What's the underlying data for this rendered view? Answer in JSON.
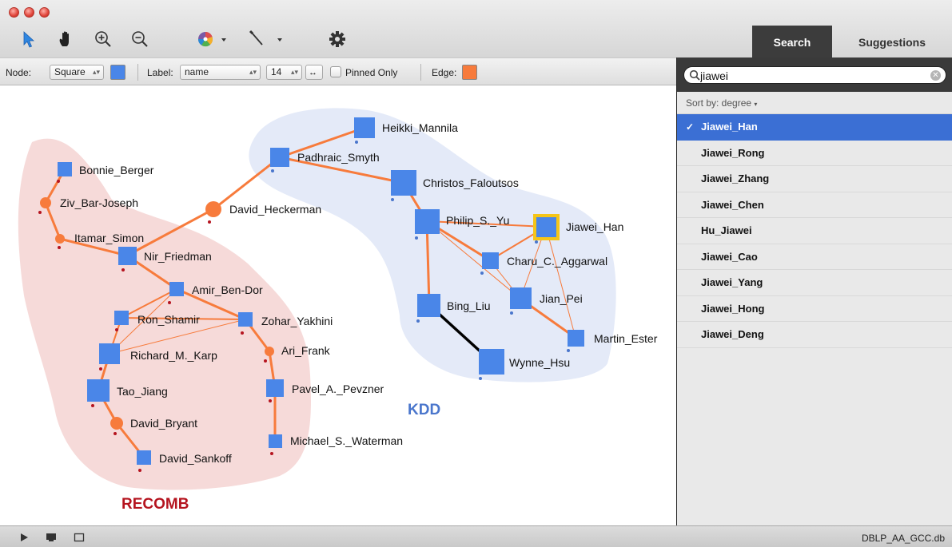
{
  "window": {
    "title_buttons": [
      "close",
      "minimize",
      "zoom"
    ]
  },
  "toolbar": {
    "tools": [
      "pointer-icon",
      "hand-icon",
      "zoom-in-icon",
      "zoom-out-icon",
      "color-wheel-icon",
      "dropdown-arrow-icon",
      "pen-icon",
      "dropdown-arrow-icon",
      "gear-icon"
    ]
  },
  "tabs": {
    "search": "Search",
    "suggestions": "Suggestions"
  },
  "options": {
    "node_label": "Node:",
    "node_shape": "Square",
    "node_color": "#4a86e8",
    "label_label": "Label:",
    "label_field": "name",
    "font_size": "14",
    "pinned_only": "Pinned Only",
    "edge_label": "Edge:",
    "edge_color": "#f77b3c"
  },
  "graph": {
    "clusters": [
      {
        "id": "recomb",
        "label": "RECOMB",
        "color": "#b5141f"
      },
      {
        "id": "kdd",
        "label": "KDD",
        "color": "#4a76cc"
      }
    ],
    "nodes": [
      {
        "id": "bonnie_berger",
        "label": "Bonnie_Berger"
      },
      {
        "id": "ziv_bar_joseph",
        "label": "Ziv_Bar-Joseph"
      },
      {
        "id": "itamar_simon",
        "label": "Itamar_Simon"
      },
      {
        "id": "nir_friedman",
        "label": "Nir_Friedman"
      },
      {
        "id": "amir_ben_dor",
        "label": "Amir_Ben-Dor"
      },
      {
        "id": "ron_shamir",
        "label": "Ron_Shamir"
      },
      {
        "id": "zohar_yakhini",
        "label": "Zohar_Yakhini"
      },
      {
        "id": "richard_karp",
        "label": "Richard_M._Karp"
      },
      {
        "id": "ari_frank",
        "label": "Ari_Frank"
      },
      {
        "id": "tao_jiang",
        "label": "Tao_Jiang"
      },
      {
        "id": "pavel_pevzner",
        "label": "Pavel_A._Pevzner"
      },
      {
        "id": "david_bryant",
        "label": "David_Bryant"
      },
      {
        "id": "michael_waterman",
        "label": "Michael_S._Waterman"
      },
      {
        "id": "david_sankoff",
        "label": "David_Sankoff"
      },
      {
        "id": "david_heckerman",
        "label": "David_Heckerman"
      },
      {
        "id": "heikki_mannila",
        "label": "Heikki_Mannila"
      },
      {
        "id": "padhraic_smyth",
        "label": "Padhraic_Smyth"
      },
      {
        "id": "christos_faloutsos",
        "label": "Christos_Faloutsos"
      },
      {
        "id": "philip_yu",
        "label": "Philip_S._Yu"
      },
      {
        "id": "jiawei_han",
        "label": "Jiawei_Han"
      },
      {
        "id": "charu_aggarwal",
        "label": "Charu_C._Aggarwal"
      },
      {
        "id": "jian_pei",
        "label": "Jian_Pei"
      },
      {
        "id": "bing_liu",
        "label": "Bing_Liu"
      },
      {
        "id": "martin_ester",
        "label": "Martin_Ester"
      },
      {
        "id": "wynne_hsu",
        "label": "Wynne_Hsu"
      }
    ]
  },
  "search": {
    "query": "jiawei",
    "sort_label": "Sort by: degree",
    "results": [
      {
        "label": "Jiawei_Han",
        "selected": true
      },
      {
        "label": "Jiawei_Rong",
        "selected": false
      },
      {
        "label": "Jiawei_Zhang",
        "selected": false
      },
      {
        "label": "Jiawei_Chen",
        "selected": false
      },
      {
        "label": "Hu_Jiawei",
        "selected": false
      },
      {
        "label": "Jiawei_Cao",
        "selected": false
      },
      {
        "label": "Jiawei_Yang",
        "selected": false
      },
      {
        "label": "Jiawei_Hong",
        "selected": false
      },
      {
        "label": "Jiawei_Deng",
        "selected": false
      }
    ]
  },
  "status": {
    "database": "DBLP_AA_GCC.db"
  }
}
